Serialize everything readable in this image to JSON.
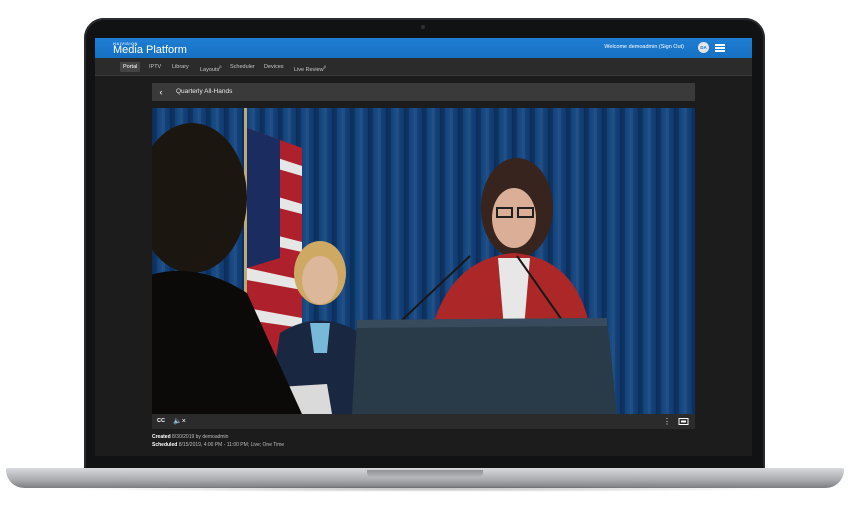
{
  "app": {
    "brand_small": "HAIVISION",
    "brand_name": "Media Platform",
    "welcome_text": "Welcome demoadmin",
    "sign_out_label": "(Sign Out)",
    "avatar_initials": "DA"
  },
  "nav": {
    "items": [
      {
        "label": "Portal",
        "active": true
      },
      {
        "label": "IPTV"
      },
      {
        "label": "Library"
      },
      {
        "label": "Layouts",
        "sup": "β"
      },
      {
        "label": "Scheduler"
      },
      {
        "label": "Devices"
      },
      {
        "label": "Live Review",
        "sup": "β"
      }
    ]
  },
  "content": {
    "back_icon": "chevron-left-icon",
    "title": "Quarterly All-Hands"
  },
  "player": {
    "cc_label": "CC",
    "mute_icon": "speaker-muted-icon",
    "more_icon": "more-vertical-icon",
    "fullscreen_icon": "fullscreen-icon"
  },
  "details": {
    "created_label": "Created",
    "created_value": "8/30/2019 by demoadmin",
    "scheduled_label": "Scheduled",
    "scheduled_value": "8/15/2019, 4:00 PM - 11:00 PM; Live; One Time"
  },
  "colors": {
    "topbar": "#1670c2",
    "navbar": "#2b2b2b",
    "background": "#1c1c1c"
  }
}
